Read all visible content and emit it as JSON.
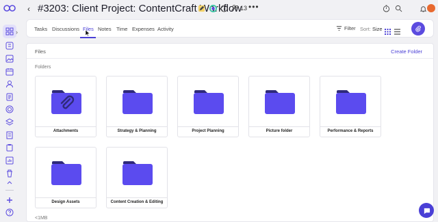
{
  "header": {
    "back_icon": "chevron-left-icon",
    "title": "#3203: Client Project: ContentCraft Workflow",
    "members_count": "13"
  },
  "tabs": [
    {
      "label": "Tasks"
    },
    {
      "label": "Discussions"
    },
    {
      "label": "Files"
    },
    {
      "label": "Notes"
    },
    {
      "label": "Time"
    },
    {
      "label": "Expenses"
    },
    {
      "label": "Activity"
    }
  ],
  "toolbar": {
    "filter_label": "Filter",
    "sort_prefix": "Sort:",
    "sort_value": "Size"
  },
  "files": {
    "title": "Files",
    "create_folder_label": "Create Folder",
    "folders_label": "Folders",
    "folders": [
      {
        "name": "Attachments",
        "icon": "paperclip-icon"
      },
      {
        "name": "Strategy & Planning"
      },
      {
        "name": "Project Planning"
      },
      {
        "name": "Picture folder"
      },
      {
        "name": "Performance & Reports"
      },
      {
        "name": "Design Assets"
      },
      {
        "name": "Content Creation & Editing"
      }
    ],
    "size_label": "<1MB"
  },
  "colors": {
    "accent": "#4a3fd6",
    "folder": "#5b4bef",
    "folder_tab": "#2f2a7a",
    "background": "#f1f1f4"
  }
}
